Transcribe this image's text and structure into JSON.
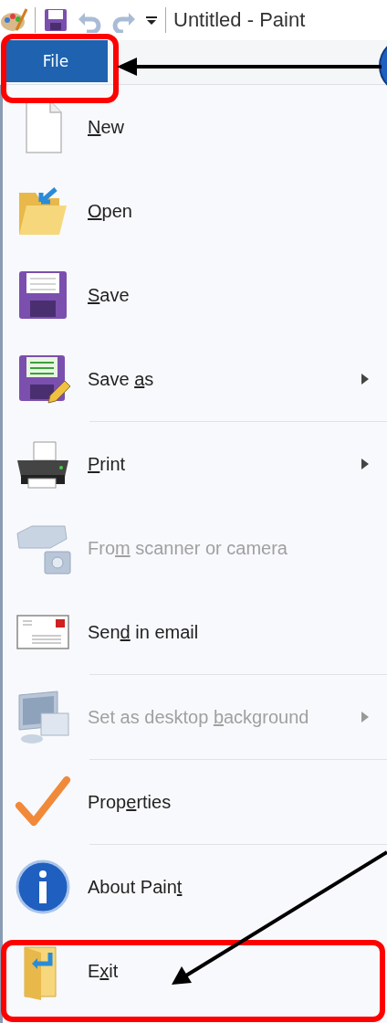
{
  "window": {
    "title": "Untitled - Paint"
  },
  "ribbon": {
    "tabs": [
      {
        "label": "File",
        "selected": true
      }
    ]
  },
  "menu": {
    "items": [
      {
        "label": {
          "key": "N",
          "after": "ew"
        },
        "disabled": false,
        "submenu": false,
        "separator_after": false
      },
      {
        "label": {
          "key": "O",
          "after": "pen"
        },
        "disabled": false,
        "submenu": false,
        "separator_after": false
      },
      {
        "label": {
          "key": "S",
          "after": "ave"
        },
        "disabled": false,
        "submenu": false,
        "separator_after": false
      },
      {
        "label": {
          "before": "Save ",
          "key": "a",
          "after": "s"
        },
        "disabled": false,
        "submenu": true,
        "separator_after": true
      },
      {
        "label": {
          "key": "P",
          "after": "rint"
        },
        "disabled": false,
        "submenu": true,
        "separator_after": false
      },
      {
        "label": {
          "before": "Fro",
          "key": "m",
          "after": " scanner or camera"
        },
        "disabled": true,
        "submenu": false,
        "separator_after": false
      },
      {
        "label": {
          "before": "Sen",
          "key": "d",
          "after": " in email"
        },
        "disabled": false,
        "submenu": false,
        "separator_after": true
      },
      {
        "label": {
          "before": "Set as desktop ",
          "key": "b",
          "after": "ackground"
        },
        "disabled": true,
        "submenu": true,
        "separator_after": true
      },
      {
        "label": {
          "before": "Prop",
          "key": "e",
          "after": "rties"
        },
        "disabled": false,
        "submenu": false,
        "separator_after": true
      },
      {
        "label": {
          "before": "About Pain",
          "key": "t"
        },
        "disabled": false,
        "submenu": false,
        "separator_after": false
      },
      {
        "label": {
          "before": "E",
          "key": "x",
          "after": "it"
        },
        "disabled": false,
        "submenu": false,
        "separator_after": false
      }
    ]
  }
}
